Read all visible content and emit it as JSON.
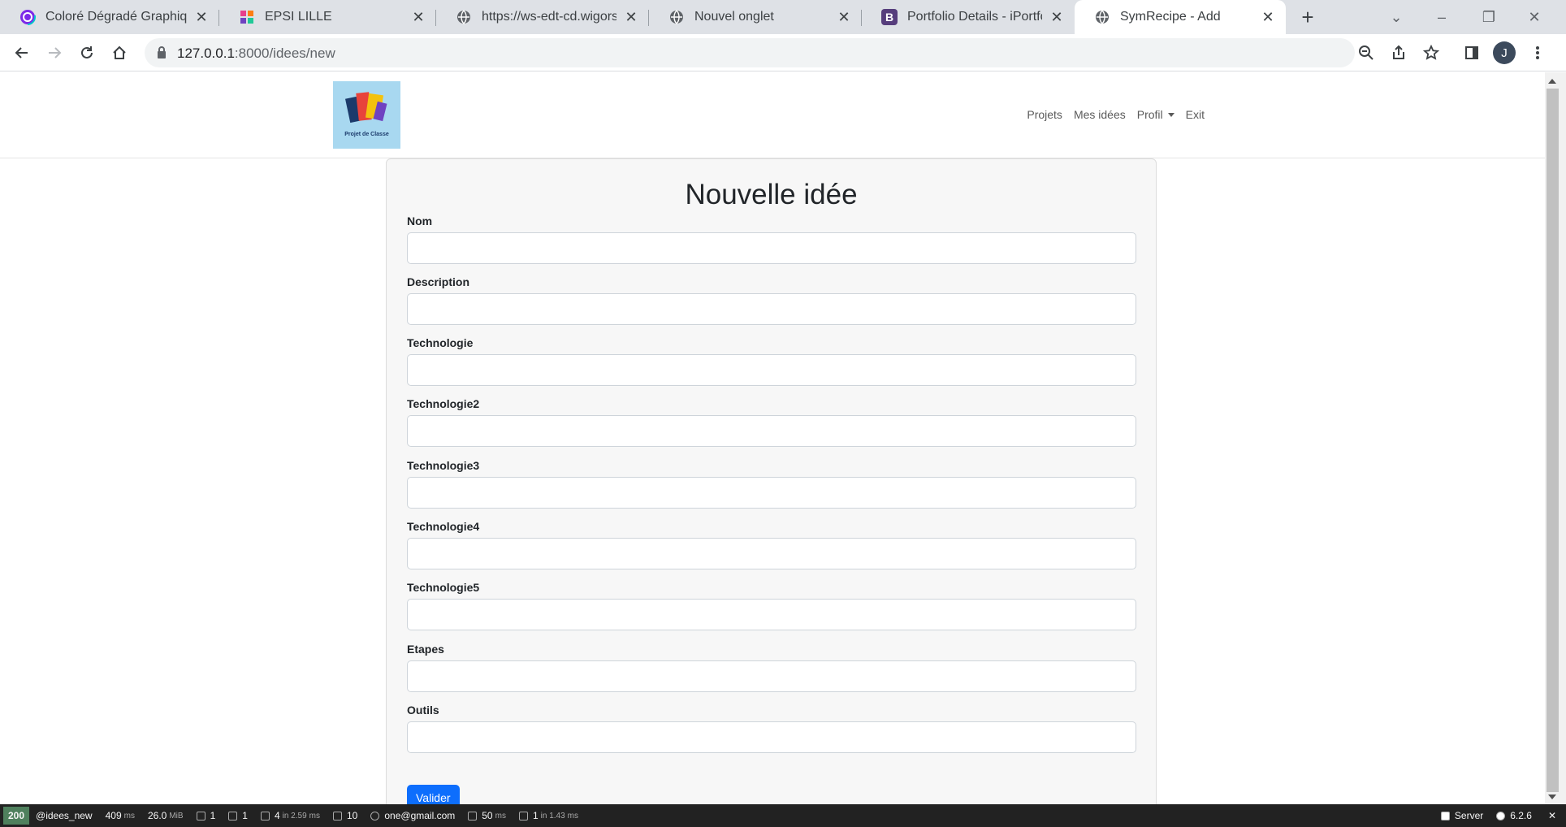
{
  "browser": {
    "tabs": [
      {
        "title": "Coloré Dégradé Graphique",
        "favicon": "canva-icon"
      },
      {
        "title": "EPSI LILLE",
        "favicon": "epsi-icon"
      },
      {
        "title": "https://ws-edt-cd.wigorserv",
        "favicon": "globe-icon"
      },
      {
        "title": "Nouvel onglet",
        "favicon": "globe-icon"
      },
      {
        "title": "Portfolio Details - iPortfolio",
        "favicon": "bootstrap-icon"
      },
      {
        "title": "SymRecipe - Add",
        "favicon": "globe-icon",
        "active": true
      }
    ],
    "url_host": "127.0.0.1",
    "url_rest": ":8000/idees/new",
    "profile_initial": "J"
  },
  "site": {
    "logo_text": "Projet de Classe",
    "nav": {
      "projets": "Projets",
      "mes_idees": "Mes idées",
      "profil": "Profil",
      "exit": "Exit"
    }
  },
  "form": {
    "title": "Nouvelle idée",
    "fields": [
      {
        "label": "Nom",
        "value": ""
      },
      {
        "label": "Description",
        "value": ""
      },
      {
        "label": "Technologie",
        "value": ""
      },
      {
        "label": "Technologie2",
        "value": ""
      },
      {
        "label": "Technologie3",
        "value": ""
      },
      {
        "label": "Technologie4",
        "value": ""
      },
      {
        "label": "Technologie5",
        "value": ""
      },
      {
        "label": "Etapes",
        "value": ""
      },
      {
        "label": "Outils",
        "value": ""
      }
    ],
    "submit_label": "Valider",
    "accent_color": "#0d6efd"
  },
  "debug_toolbar": {
    "status": "200",
    "route": "@idees_new",
    "time_value": "409",
    "time_unit": "ms",
    "memory_value": "26.0",
    "memory_unit": "MiB",
    "forms": "1",
    "logs": "1",
    "templates": "4",
    "templates_time": "in 2.59",
    "templates_unit": "ms",
    "translations": "10",
    "user": "one@gmail.com",
    "cache_value": "50",
    "cache_unit": "ms",
    "db": "1",
    "db_time": "in 1.43",
    "db_unit": "ms",
    "server": "Server",
    "symfony_version": "6.2.6"
  }
}
